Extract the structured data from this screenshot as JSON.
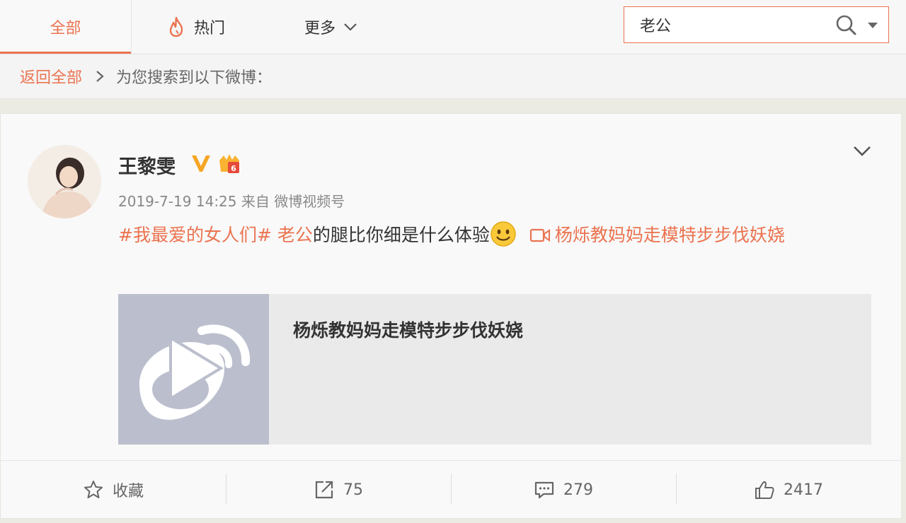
{
  "tabs": {
    "all": "全部",
    "hot": "热门",
    "more": "更多"
  },
  "search": {
    "value": "老公"
  },
  "breadcrumb": {
    "back": "返回全部",
    "text": "为您搜索到以下微博："
  },
  "post": {
    "user_name": "王黎雯",
    "timestamp": "2019-7-19 14:25",
    "source_prefix": "来自",
    "source": "微博视频号",
    "hashtag": "#我最爱的女人们#",
    "keyword": "老公",
    "body": "的腿比你细是什么体验",
    "video_link": "杨烁教妈妈走模特步步伐妖娆",
    "video_card_title": "杨烁教妈妈走模特步步伐妖娆"
  },
  "actions": {
    "favorite_label": "收藏",
    "repost_count": "75",
    "comment_count": "279",
    "like_count": "2417"
  },
  "colors": {
    "accent": "#eb7350",
    "verified": "#f5a623"
  },
  "icons": [
    "fire-icon",
    "chevron-down-icon",
    "search-icon",
    "caret-down-icon",
    "chevron-right-icon",
    "verified-v-icon",
    "vip-crown-icon",
    "smiley-icon",
    "video-icon",
    "weibo-play-icon",
    "star-icon",
    "repost-icon",
    "comment-icon",
    "like-icon"
  ]
}
